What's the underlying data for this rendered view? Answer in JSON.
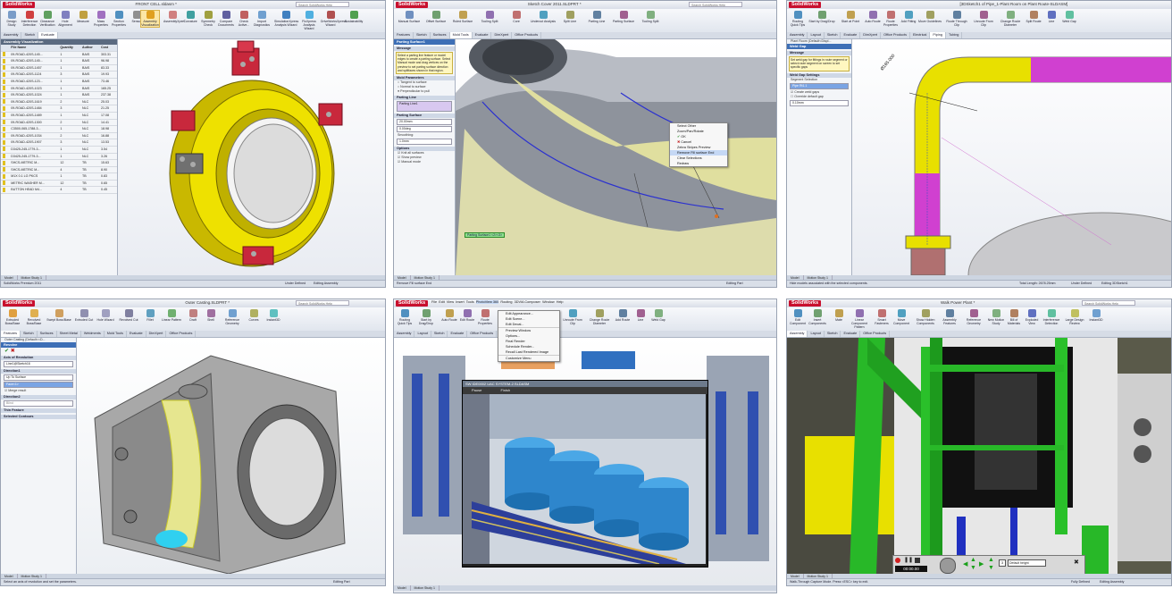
{
  "brand": "SolidWorks",
  "w1": {
    "title": "FRONT CELL.sldasm *",
    "search": "Search SolidWorks Help",
    "ribbon": [
      "Design Study",
      "Interference Detection",
      "Clearance Verification",
      "Hole Alignment",
      "Measure",
      "Mass Properties",
      "Section Properties",
      "Sensor",
      "Assembly Visualization",
      "AssemblyXpert",
      "Curvature",
      "Symmetry Check",
      "Compare Documents",
      "Check Active...",
      "Import Diagnostics",
      "SimulationXpress Analysis Wizard",
      "FloXpress Analysis Wizard",
      "DriveWorksXpress Wizard",
      "Sustainability"
    ],
    "tabs": [
      "Assembly",
      "Sketch",
      "Evaluate"
    ],
    "panel_title": "Assembly Visualization",
    "columns": [
      "File Name",
      "Quantity",
      "Author",
      "Cost"
    ],
    "rows": [
      [
        "09-ROAD-420S-145...",
        "1",
        "BAIS",
        "303.31"
      ],
      [
        "09-ROAD-420S-145...",
        "1",
        "BAIS",
        "96.98"
      ],
      [
        "09-ROAD-420S-1457",
        "1",
        "BAIS",
        "83.33"
      ],
      [
        "09-ROAD-420S-1124",
        "3",
        "BAIS",
        "19.93"
      ],
      [
        "09-ROAD-420S-123...",
        "1",
        "BAIS",
        "73.46"
      ],
      [
        "09-ROAD-420S-1023",
        "1",
        "BAIS",
        "165.25"
      ],
      [
        "09-ROAD-420S-1024",
        "1",
        "BAIS",
        "237.38"
      ],
      [
        "09-ROAD-420S-1619",
        "2",
        "NLC",
        "25.03"
      ],
      [
        "09-ROAD-420S-1484",
        "3",
        "NLC",
        "21.25"
      ],
      [
        "09-ROAD-420S-1489",
        "1",
        "NLC",
        "17.08"
      ],
      [
        "09-ROAD-420S-1300",
        "2",
        "NLC",
        "14.41"
      ],
      [
        "C3500-065-1788-3...",
        "1",
        "NLC",
        "18.98"
      ],
      [
        "09-ROAD-420S-1034",
        "2",
        "NLC",
        "16.88"
      ],
      [
        "09-ROAD-420S-1907",
        "3",
        "NLC",
        "13.53"
      ],
      [
        "D3425-245-1779-3...",
        "1",
        "NLC",
        "3.54"
      ],
      [
        "D3425-245-1779-3...",
        "1",
        "NLC",
        "3.26"
      ],
      [
        "SHCS-METRIC M...",
        "12",
        "TB",
        "15.63"
      ],
      [
        "SHCS-METRIC M...",
        "4",
        "TB",
        "8.90"
      ],
      [
        "M1X 0.1 LG PKCS",
        "1",
        "TB",
        "0.83"
      ],
      [
        "METRIC WASHER M...",
        "12",
        "TB",
        "0.65"
      ],
      [
        "BUTTON HEAD M4...",
        "4",
        "TB",
        "0.45"
      ]
    ],
    "context_menu": [
      "TOTAL COST",
      "Author",
      "Cost",
      "Total Weight",
      "Mass",
      "More...",
      "Edit Column",
      "Add Column",
      "Delete Column",
      "Unit Precision",
      "Value Bars",
      "Add Display State",
      "Save As..."
    ],
    "status_left": "SolidWorks Premium 2011",
    "status_mid": "Under Defined",
    "status_right": "Editing Assembly",
    "model_tabs": [
      "Model",
      "Motion Study 1"
    ]
  },
  "w2": {
    "title": "Sketch Cover 2011.SLDPRT *",
    "search": "Search SolidWorks Help",
    "ribbon": [
      "Manual Surface",
      "Offset Surface",
      "Ruled Surface",
      "Split Line",
      "Shut-off Surfaces",
      "Parting Line",
      "Parting Surface",
      "Tooling Split",
      "Core",
      "Draft Analysis",
      "Undercut Analysis",
      "Scale",
      "Draft",
      "Insert Mold Folder"
    ],
    "tabs": [
      "Features",
      "Sketch",
      "Surfaces",
      "Mold Tools",
      "Evaluate",
      "DimXpert",
      "Office Products"
    ],
    "panel_title": "Parting Surface1",
    "message_hdr": "Message",
    "message": "Select a parting line feature or model edges to create a parting surface. Select Manual mode and drag vertices on the preview to set parting surface direction and splitfaces shown in that region.",
    "mold_hdr": "Mold Parameters",
    "mold_opts": [
      "Tangent to surface",
      "Normal to surface",
      "Perpendicular to pull"
    ],
    "pline_hdr": "Parting Line",
    "pline_val": "Parting Line1",
    "psurf_hdr": "Parting Surface",
    "psurf_val": "20.00mm",
    "psurf_val2": "0.00deg",
    "smooth_lbl": "Smoothing:",
    "smooth_val": "1.0mm",
    "options_hdr": "Options",
    "options": [
      "Knit all surfaces",
      "Show preview",
      "Manual mode"
    ],
    "ctx": [
      "Select Other",
      "Zoom/Pan/Rotate",
      "OK",
      "Cancel",
      "Zebra Stripes Preview",
      "Remove Fill surface End",
      "Clear Selections",
      "Redraw"
    ],
    "tag": "Parting Surface1 <2><3>",
    "status_left": "Remove Fill surface End",
    "status_right": "Editing Part",
    "model_tabs": [
      "Model",
      "Motion Study 1"
    ]
  },
  "w3": {
    "title": "[3DSketch1 of Pipe_1-Plant Room on Plant Route-SLDASM]",
    "search": "Search SolidWorks Help",
    "ribbon": [
      "Routing Quick Tips",
      "Start by Drag/Drop",
      "Start at Point",
      "Auto Route",
      "Route Properties",
      "Add Fitting",
      "Move Guidelines",
      "Edit Route",
      "Route Through Clip",
      "Unroute From Clip",
      "Covering",
      "Change Route Diameter",
      "Split Route",
      "Line",
      "Spline",
      "Add Clip",
      "Weld Gap",
      "Pipe Drawing"
    ],
    "tabs": [
      "Assembly",
      "Layout",
      "Sketch",
      "Evaluate",
      "DimXpert",
      "Office Products",
      "Electrical",
      "Piping",
      "Tubing"
    ],
    "tree": "Plant Room (Default<Displ...",
    "panel_title": "Weld Gap",
    "message_hdr": "Message",
    "message": "Set weld gap for fittings in route segment or select route segment on screen to set specific gaps",
    "settings_hdr": "Weld Gap Settings",
    "seg_lbl": "Segment Selection",
    "seg_val": "Pipe Rt1.1",
    "gap_lbl": "Create weld gaps",
    "override_lbl": "Override default gap",
    "gap_val": "0.10mm",
    "dim": "Ø165.000",
    "status_left": "Hide models associated with the selected components.",
    "status_mid": "Total Length: 2678.25mm",
    "status_right": "Under Defined",
    "status_edit": "Editing 3DSketch1",
    "model_tabs": [
      "Model",
      "Motion Study 1"
    ]
  },
  "w4": {
    "title": "Outer Casting.SLDPRT *",
    "search": "Search SolidWorks Help",
    "ribbon": [
      "Extruded Boss/Base",
      "Revolved Boss/Base",
      "Swept Boss/Base",
      "Lofted Boss/Base",
      "Boundary Boss/Base",
      "Extruded Cut",
      "Hole Wizard",
      "Revolved Cut",
      "Swept Cut",
      "Lofted Cut",
      "Boundary Cut",
      "Fillet",
      "Linear Pattern",
      "Rib",
      "Draft",
      "Shell",
      "Wrap",
      "Intersect",
      "Mirror",
      "Reference Geometry",
      "Curves",
      "Instant3D"
    ],
    "tabs": [
      "Features",
      "Sketch",
      "Surfaces",
      "Sheet Metal",
      "Weldments",
      "Mold Tools",
      "Evaluate",
      "DimXpert",
      "Office Products"
    ],
    "tree": "Outer Casting (Default<<D...",
    "panel_title": "Revolve",
    "axis_hdr": "Axis of Revolution",
    "axis_val": "Line1@Sketch16",
    "dir_hdr": "Direction1",
    "dir_val": "Up To Surface",
    "face_val": "Face<1>",
    "merge": "Merge result",
    "dir2_hdr": "Direction2",
    "dir2_val": "Blind",
    "thin_hdr": "Thin Feature",
    "sel_hdr": "Selected Contours",
    "status_left": "Select an axis of revolution and set the parameters.",
    "status_right": "Editing Part",
    "model_tabs": [
      "Model",
      "Motion Study 1"
    ]
  },
  "w5": {
    "menubar": [
      "File",
      "Edit",
      "View",
      "Insert",
      "Tools",
      "PhotoView 360",
      "Routing",
      "3DVIA Composer",
      "Window",
      "Help"
    ],
    "ribbon": [
      "Routing Quick Tips",
      "Start by Drag/Drop",
      "Start at Point",
      "Auto Route",
      "Edit Route",
      "Route Properties",
      "Unroute From Clip",
      "Change Route Diameter",
      "Split Route",
      "Add Route",
      "Line",
      "Weld Gap"
    ],
    "tabs": [
      "Assembly",
      "Layout",
      "Sketch",
      "Evaluate",
      "Office Products",
      "Piping",
      "Tubing",
      "Routing"
    ],
    "menu": [
      "Edit Appearance...",
      "Edit Scene...",
      "Edit Decal...",
      "Preview Window",
      "Options...",
      "Final Render",
      "Schedule Render...",
      "Recall Last Rendered Image",
      "Customize Menu"
    ],
    "render_title": "SW IDE0002 UAC SYSTEM-2.SLDASM",
    "render_btns": [
      "Pause",
      "Finish"
    ],
    "model_tabs": [
      "Model",
      "Motion Study 1"
    ]
  },
  "w6": {
    "title": "Walk Power Plant *",
    "search": "Search SolidWorks Help",
    "ribbon": [
      "Edit Component",
      "Insert Components",
      "Mate",
      "Linear Component Pattern",
      "Smart Fasteners",
      "Move Component",
      "Show Hidden Components",
      "Assembly Features",
      "Reference Geometry",
      "New Motion Study",
      "Bill of Materials",
      "Exploded View",
      "Explode Line Sketch",
      "Interference Detection",
      "Clearance Verification",
      "Large Design Review",
      "Instant3D"
    ],
    "tabs": [
      "Assembly",
      "Layout",
      "Sketch",
      "Evaluate",
      "Office Products"
    ],
    "timer": "00:00.00",
    "speed": "3",
    "height_val": "Default height",
    "status_left": "Walk-Through Capture Mode.  Press <ESC> key to exit.",
    "status_mid": "Fully Defined",
    "status_right": "Editing Assembly",
    "model_tabs": [
      "Model",
      "Motion Study 1"
    ]
  },
  "colors": {
    "sw_red": "#c8102e",
    "ribbon_blue": "#3d6fb6",
    "yellow_part": "#e8e000",
    "magenta": "#d040d0",
    "green_steel": "#28b828"
  }
}
